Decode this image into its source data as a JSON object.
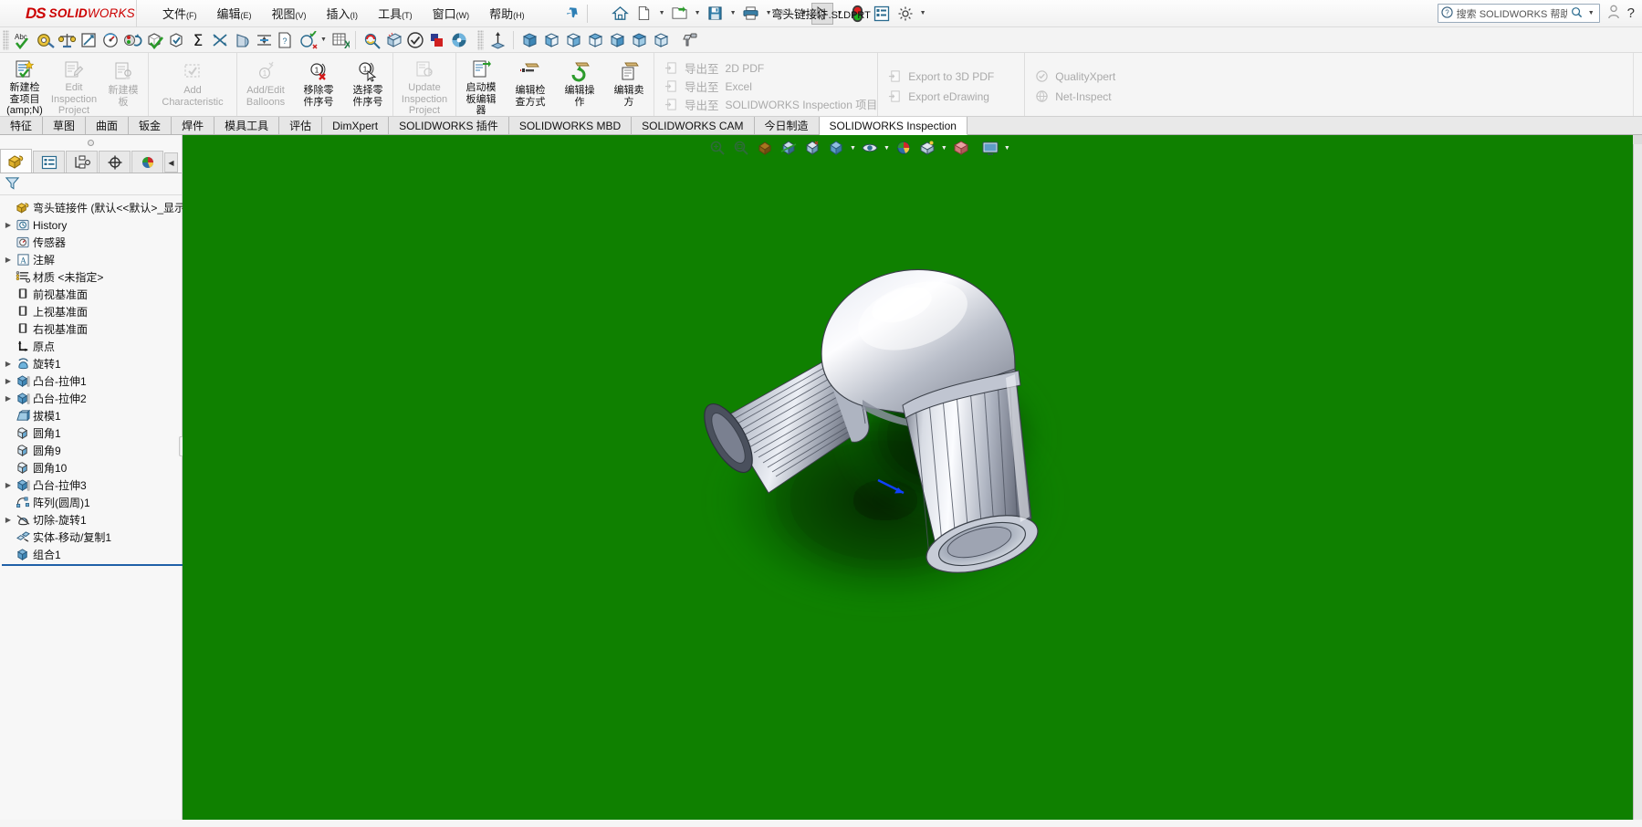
{
  "app": {
    "brand_ds": "DS",
    "brand_solid": "SOLID",
    "brand_works": "WORKS",
    "document_title": "弯头链接件",
    "document_ext": ".SLDPRT"
  },
  "menubar": {
    "items": [
      {
        "label": "文件",
        "accel": "(F)"
      },
      {
        "label": "编辑",
        "accel": "(E)"
      },
      {
        "label": "视图",
        "accel": "(V)"
      },
      {
        "label": "插入",
        "accel": "(I)"
      },
      {
        "label": "工具",
        "accel": "(T)"
      },
      {
        "label": "窗口",
        "accel": "(W)"
      },
      {
        "label": "帮助",
        "accel": "(H)"
      }
    ],
    "pin_icon": "pin-icon"
  },
  "quick_access": {
    "items": [
      {
        "name": "home-icon",
        "caret": false
      },
      {
        "name": "new-document-icon",
        "caret": true
      },
      {
        "name": "open-folder-icon",
        "caret": true
      },
      {
        "name": "save-icon",
        "caret": true
      },
      {
        "name": "print-icon",
        "caret": true
      },
      {
        "name": "undo-icon",
        "caret": true,
        "disabled": true
      },
      {
        "name": "select-cursor-icon",
        "caret": true,
        "selected": true
      },
      {
        "name": "rebuild-icon",
        "caret": false
      },
      {
        "name": "options-list-icon",
        "caret": false
      },
      {
        "name": "gear-settings-icon",
        "caret": true
      }
    ]
  },
  "search": {
    "placeholder": "搜索 SOLIDWORKS 帮助",
    "help_icon": "question-circle-icon",
    "magnifier_icon": "search-icon",
    "dropdown_icon": "chevron-down-icon",
    "profile_icon": "user-icon",
    "help_mark": "?"
  },
  "toolstrip": {
    "icons_left": [
      "abc-spellcheck-icon",
      "measure-icon",
      "mass-properties-icon",
      "section-properties-icon",
      "sensor-gauge-icon",
      "simulation-icon",
      "check-geometry-icon",
      "geometry-analysis-icon",
      "sum-equation-icon",
      "interference-detection-icon",
      "draft-analysis-icon",
      "thickness-analysis-icon",
      "compare-documents-icon",
      "check-sketch-icon"
    ],
    "icons_mid": [
      "excel-export-icon"
    ],
    "icons_render": [
      "realview-icon",
      "scene-icon",
      "validate-icon",
      "appearance-icon",
      "rotate-view-icon"
    ],
    "icons_views": [
      "normal-to-icon",
      "iso-view-icon",
      "front-view-icon",
      "back-view-icon",
      "left-view-icon",
      "right-view-icon",
      "top-view-icon",
      "bottom-view-icon",
      "paint-appearance-icon"
    ]
  },
  "ribbon": {
    "groups": [
      {
        "buttons": [
          {
            "name": "new-inspection-project-button",
            "label": "新建检查项目(amp;N)",
            "label_lines": [
              "新建检",
              "查项目",
              "(amp;N)"
            ],
            "icon": "new-inspection-icon",
            "disabled": false
          },
          {
            "name": "edit-inspection-project-button",
            "label": "Edit Inspection Project",
            "label_lines": [
              "Edit",
              "Inspection",
              "Project"
            ],
            "icon": "edit-inspection-icon",
            "disabled": true
          },
          {
            "name": "new-template-button",
            "label": "新建模板",
            "label_lines": [
              "新建模",
              "板"
            ],
            "icon": "new-template-icon",
            "disabled": true
          }
        ]
      },
      {
        "buttons": [
          {
            "name": "add-characteristic-button",
            "label": "Add Characteristic",
            "label_lines": [
              "Add",
              "Characteristic"
            ],
            "icon": "add-characteristic-icon",
            "disabled": true
          }
        ]
      },
      {
        "buttons": [
          {
            "name": "add-edit-balloons-button",
            "label": "Add/Edit Balloons",
            "label_lines": [
              "Add/Edit",
              "Balloons"
            ],
            "icon": "add-edit-balloons-icon",
            "disabled": true
          },
          {
            "name": "remove-balloon-button",
            "label": "移除零件序号",
            "label_lines": [
              "移除零",
              "件序号"
            ],
            "icon": "remove-balloon-icon",
            "disabled": false
          },
          {
            "name": "select-balloon-button",
            "label": "选择零件序号",
            "label_lines": [
              "选择零",
              "件序号"
            ],
            "icon": "select-balloon-icon",
            "disabled": false
          }
        ]
      },
      {
        "buttons": [
          {
            "name": "update-inspection-project-button",
            "label": "Update Inspection Project",
            "label_lines": [
              "Update",
              "Inspection",
              "Project"
            ],
            "icon": "update-inspection-icon",
            "disabled": true
          }
        ]
      },
      {
        "buttons": [
          {
            "name": "launch-template-editor-button",
            "label": "启动模板编辑器",
            "label_lines": [
              "启动模",
              "板编辑",
              "器"
            ],
            "icon": "launch-template-editor-icon",
            "disabled": false
          },
          {
            "name": "edit-inspection-method-button",
            "label": "编辑检查方式",
            "label_lines": [
              "编辑检",
              "查方式"
            ],
            "icon": "edit-inspection-method-icon",
            "disabled": false
          },
          {
            "name": "edit-operation-button",
            "label": "编辑操作",
            "label_lines": [
              "编辑操",
              "作"
            ],
            "icon": "edit-operation-icon",
            "disabled": false
          },
          {
            "name": "edit-vendor-button",
            "label": "编辑卖方",
            "label_lines": [
              "编辑卖",
              "方"
            ],
            "icon": "edit-vendor-icon",
            "disabled": false
          }
        ]
      },
      {
        "list": [
          {
            "name": "export-2d-pdf-item",
            "label_cn": "导出至",
            "label_en": "2D PDF",
            "icon": "export-pdf-icon"
          },
          {
            "name": "export-excel-item",
            "label_cn": "导出至",
            "label_en": "Excel",
            "icon": "export-excel-icon"
          },
          {
            "name": "export-swi-project-item",
            "label_cn": "导出至",
            "label_en": "SOLIDWORKS Inspection 项目",
            "icon": "export-swi-icon"
          }
        ]
      },
      {
        "list": [
          {
            "name": "export-3d-pdf-item",
            "label_cn": "",
            "label_en": "Export to 3D PDF",
            "icon": "export-3dpdf-icon"
          },
          {
            "name": "export-edrawing-item",
            "label_cn": "",
            "label_en": "Export eDrawing",
            "icon": "export-edrawing-icon"
          }
        ]
      },
      {
        "list": [
          {
            "name": "qualityxpert-item",
            "label_cn": "",
            "label_en": "QualityXpert",
            "icon": "qualityxpert-icon"
          },
          {
            "name": "net-inspect-item",
            "label_cn": "",
            "label_en": "Net-Inspect",
            "icon": "net-inspect-icon"
          }
        ]
      }
    ]
  },
  "ribbon_tabs": {
    "items": [
      {
        "label": "特征",
        "active": false
      },
      {
        "label": "草图",
        "active": false
      },
      {
        "label": "曲面",
        "active": false
      },
      {
        "label": "钣金",
        "active": false
      },
      {
        "label": "焊件",
        "active": false
      },
      {
        "label": "模具工具",
        "active": false
      },
      {
        "label": "评估",
        "active": false
      },
      {
        "label": "DimXpert",
        "active": false
      },
      {
        "label": "SOLIDWORKS 插件",
        "active": false
      },
      {
        "label": "SOLIDWORKS MBD",
        "active": false
      },
      {
        "label": "SOLIDWORKS CAM",
        "active": false
      },
      {
        "label": "今日制造",
        "active": false
      },
      {
        "label": "SOLIDWORKS Inspection",
        "active": true
      }
    ]
  },
  "left_panel": {
    "tabs": [
      {
        "name": "feature-manager-tab",
        "icon": "yellow-part-icon",
        "active": true
      },
      {
        "name": "property-manager-tab",
        "icon": "property-list-icon",
        "active": false
      },
      {
        "name": "configuration-manager-tab",
        "icon": "configuration-icon",
        "active": false
      },
      {
        "name": "dimxpert-manager-tab",
        "icon": "dimxpert-target-icon",
        "active": false
      },
      {
        "name": "display-manager-tab",
        "icon": "display-sphere-icon",
        "active": false
      }
    ],
    "collapse_arrow": "chevron-left-icon",
    "filter_icon": "filter-funnel-icon",
    "tree": [
      {
        "label": "弯头链接件  (默认<<默认>_显示状态",
        "icon": "yellow-part-icon",
        "arrow": false,
        "indent": 0,
        "root": true
      },
      {
        "label": "History",
        "icon": "history-folder-icon",
        "arrow": true,
        "indent": 1
      },
      {
        "label": "传感器",
        "icon": "sensor-folder-icon",
        "arrow": false,
        "indent": 1
      },
      {
        "label": "注解",
        "icon": "annotations-icon",
        "arrow": true,
        "indent": 1
      },
      {
        "label": "材质 <未指定>",
        "icon": "material-icon",
        "arrow": false,
        "indent": 1
      },
      {
        "label": "前视基准面",
        "icon": "plane-icon",
        "arrow": false,
        "indent": 1
      },
      {
        "label": "上视基准面",
        "icon": "plane-icon",
        "arrow": false,
        "indent": 1
      },
      {
        "label": "右视基准面",
        "icon": "plane-icon",
        "arrow": false,
        "indent": 1
      },
      {
        "label": "原点",
        "icon": "origin-icon",
        "arrow": false,
        "indent": 1
      },
      {
        "label": "旋转1",
        "icon": "revolve-icon",
        "arrow": true,
        "indent": 1
      },
      {
        "label": "凸台-拉伸1",
        "icon": "extrude-boss-icon",
        "arrow": true,
        "indent": 1
      },
      {
        "label": "凸台-拉伸2",
        "icon": "extrude-boss-icon",
        "arrow": true,
        "indent": 1
      },
      {
        "label": "拔模1",
        "icon": "draft-icon",
        "arrow": false,
        "indent": 1
      },
      {
        "label": "圆角1",
        "icon": "fillet-icon",
        "arrow": false,
        "indent": 1
      },
      {
        "label": "圆角9",
        "icon": "fillet-icon",
        "arrow": false,
        "indent": 1
      },
      {
        "label": "圆角10",
        "icon": "fillet-icon",
        "arrow": false,
        "indent": 1
      },
      {
        "label": "凸台-拉伸3",
        "icon": "extrude-boss-icon",
        "arrow": true,
        "indent": 1
      },
      {
        "label": "阵列(圆周)1",
        "icon": "circular-pattern-icon",
        "arrow": false,
        "indent": 1
      },
      {
        "label": "切除-旋转1",
        "icon": "revolve-cut-icon",
        "arrow": true,
        "indent": 1
      },
      {
        "label": "实体-移动/复制1",
        "icon": "move-copy-body-icon",
        "arrow": false,
        "indent": 1
      },
      {
        "label": "组合1",
        "icon": "combine-icon",
        "arrow": false,
        "indent": 1
      }
    ]
  },
  "viewport": {
    "background_color": "#0f8000",
    "toolbar": [
      {
        "name": "zoom-to-fit-icon",
        "caret": false
      },
      {
        "name": "zoom-area-icon",
        "caret": false
      },
      {
        "name": "previous-view-icon",
        "caret": false
      },
      {
        "name": "section-view-icon",
        "caret": false
      },
      {
        "name": "view-orientation-icon",
        "caret": false
      },
      {
        "name": "display-style-icon",
        "caret": true
      },
      {
        "name": "hide-show-items-icon",
        "caret": true
      },
      {
        "name": "edit-appearance-icon",
        "caret": false
      },
      {
        "name": "apply-scene-icon",
        "caret": true
      },
      {
        "name": "view-settings-icon",
        "caret": false
      },
      {
        "name": "viewport-layout-icon",
        "caret": true
      }
    ],
    "model": {
      "name": "elbow-pipe-fitting-model",
      "description": "90 degree elbow pipe connector with ribbed ends",
      "body_color": "#c9ccd6",
      "highlight_color": "#ffffff",
      "shadow_color": "#054000",
      "triad_color": "#1040ff"
    }
  },
  "colors": {
    "brand_red": "#cc0000",
    "viewport_green": "#0f8000",
    "tab_active": "#ffffff",
    "selection_blue": "#2060a8",
    "ribbon_bg": "#f5f5f5"
  }
}
